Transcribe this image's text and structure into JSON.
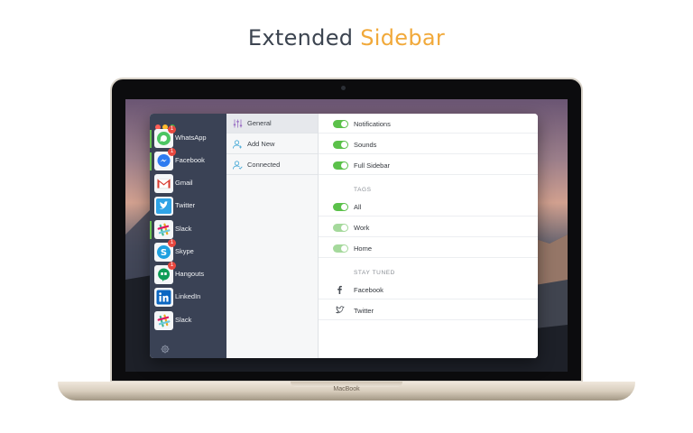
{
  "headline": {
    "main": "Extended",
    "accent": "Sidebar"
  },
  "device": {
    "brand": "MacBook"
  },
  "apps": [
    {
      "label": "WhatsApp",
      "badge": "1",
      "active": true
    },
    {
      "label": "Facebook",
      "badge": "1",
      "active": true
    },
    {
      "label": "Gmail",
      "badge": "",
      "active": false
    },
    {
      "label": "Twitter",
      "badge": "",
      "active": false
    },
    {
      "label": "Slack",
      "badge": "",
      "active": true
    },
    {
      "label": "Skype",
      "badge": "1",
      "active": false
    },
    {
      "label": "Hangouts",
      "badge": "1",
      "active": false
    },
    {
      "label": "LinkedIn",
      "badge": "",
      "active": false
    },
    {
      "label": "Slack",
      "badge": "",
      "active": false
    }
  ],
  "menu": [
    {
      "label": "General",
      "icon": "sliders-icon",
      "selected": true
    },
    {
      "label": "Add New",
      "icon": "add-user-icon",
      "selected": false
    },
    {
      "label": "Connected",
      "icon": "user-check-icon",
      "selected": false
    }
  ],
  "settings": {
    "toggles": [
      {
        "label": "Notifications",
        "on": true
      },
      {
        "label": "Sounds",
        "on": true
      },
      {
        "label": "Full Sidebar",
        "on": true
      }
    ],
    "tags_header": "TAGS",
    "tags": [
      {
        "label": "All",
        "on": true
      },
      {
        "label": "Work",
        "on": true,
        "dimmed": true
      },
      {
        "label": "Home",
        "on": true,
        "dimmed": true
      }
    ],
    "stay_tuned_header": "STAY TUNED",
    "social": [
      {
        "label": "Facebook",
        "icon": "facebook-icon"
      },
      {
        "label": "Twitter",
        "icon": "twitter-icon"
      }
    ]
  },
  "colors": {
    "accent": "#f1a93a",
    "toggle_on": "#5bc14a",
    "sidebar": "#3a4255",
    "badge": "#e8483f"
  }
}
